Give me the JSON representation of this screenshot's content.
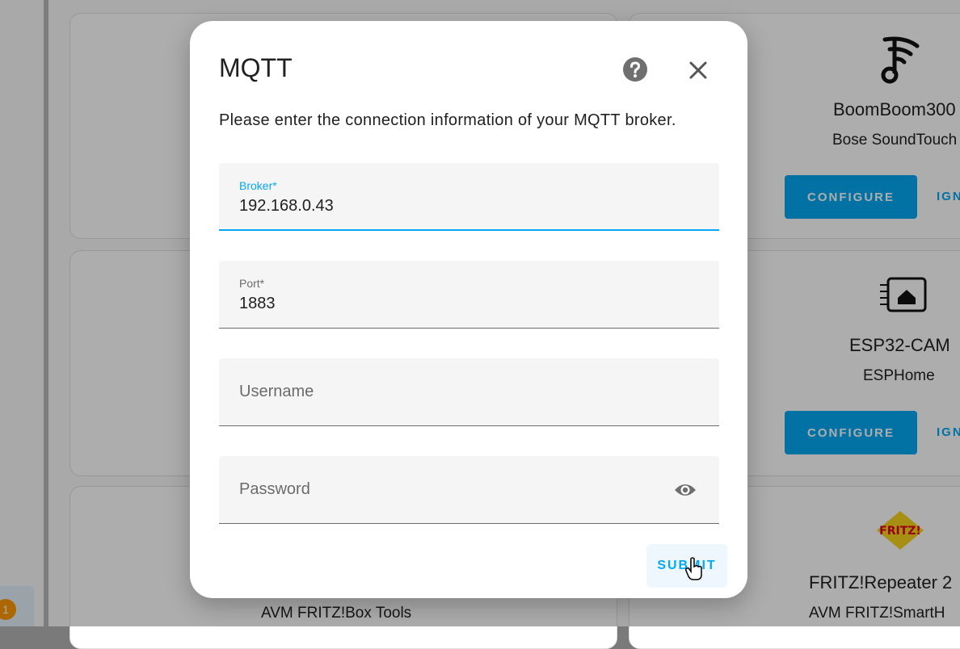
{
  "background": {
    "notification_count": "1",
    "cards": [
      {
        "title": "BoomBoom300",
        "subtitle": "Bose SoundTouch",
        "configure_label": "CONFIGURE",
        "ignore_label": "IGN",
        "icon": "music-wifi-icon"
      },
      {
        "title": "ESP32-CAM",
        "subtitle": "ESPHome",
        "configure_label": "CONFIGURE",
        "ignore_label": "IGN",
        "icon": "chip-home-icon"
      },
      {
        "title": "FRITZ!Repeater 2",
        "subtitle": "AVM FRITZ!SmartH",
        "icon": "fritz-logo-icon"
      }
    ],
    "left_card_subtitle": "AVM FRITZ!Box Tools"
  },
  "dialog": {
    "title": "MQTT",
    "description": "Please enter the connection information of your MQTT broker.",
    "fields": {
      "broker": {
        "label": "Broker*",
        "value": "192.168.0.43"
      },
      "port": {
        "label": "Port*",
        "value": "1883"
      },
      "username": {
        "placeholder": "Username",
        "value": ""
      },
      "password": {
        "placeholder": "Password",
        "value": ""
      }
    },
    "submit_label": "SUBMIT"
  },
  "colors": {
    "accent": "#03a9f4",
    "badge": "#ff9800",
    "text": "#212121"
  }
}
